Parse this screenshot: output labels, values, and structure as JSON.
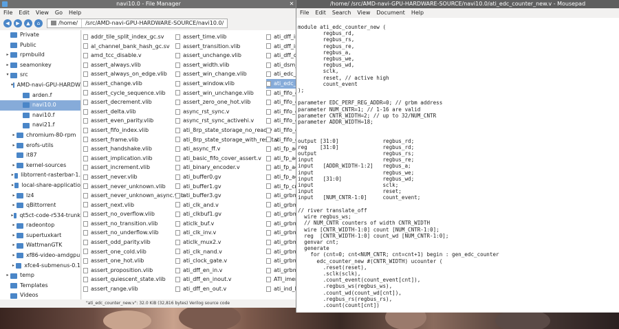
{
  "file_manager": {
    "title": "navi10.0 - File Manager",
    "menu": [
      "File",
      "Edit",
      "View",
      "Go",
      "Help"
    ],
    "path_segments": [
      "/home/",
      "/src/AMD-navi-GPU-HARDWARE-SOURCE/navi10.0/"
    ],
    "sidebar": [
      {
        "label": "Private",
        "indent": 1,
        "arrow": "",
        "color": "#4a86c8"
      },
      {
        "label": "Public",
        "indent": 1,
        "arrow": "",
        "color": "#4a86c8"
      },
      {
        "label": "rpmbuild",
        "indent": 1,
        "arrow": "▸",
        "color": "#4a86c8"
      },
      {
        "label": "seamonkey",
        "indent": 1,
        "arrow": "▸",
        "color": "#4a86c8"
      },
      {
        "label": "src",
        "indent": 1,
        "arrow": "▾",
        "color": "#4a86c8"
      },
      {
        "label": "AMD-navi-GPU-HARDW",
        "indent": 2,
        "arrow": "▾",
        "color": "#4a86c8"
      },
      {
        "label": "arden.f",
        "indent": 3,
        "arrow": "",
        "color": "#4a86c8"
      },
      {
        "label": "navi10.0",
        "indent": 3,
        "arrow": "",
        "color": "#4a86c8",
        "selected": true
      },
      {
        "label": "navi10.f",
        "indent": 3,
        "arrow": "",
        "color": "#4a86c8"
      },
      {
        "label": "navi21.f",
        "indent": 3,
        "arrow": "",
        "color": "#4a86c8"
      },
      {
        "label": "chromium-80-rpm",
        "indent": 2,
        "arrow": "▸",
        "color": "#4a86c8"
      },
      {
        "label": "erofs-utils",
        "indent": 2,
        "arrow": "▸",
        "color": "#4a86c8"
      },
      {
        "label": "it87",
        "indent": 2,
        "arrow": "",
        "color": "#4a86c8"
      },
      {
        "label": "kernel-sources",
        "indent": 2,
        "arrow": "▸",
        "color": "#4a86c8"
      },
      {
        "label": "libtorrent-rasterbar-1.",
        "indent": 2,
        "arrow": "▸",
        "color": "#4a86c8"
      },
      {
        "label": "local-share-applicatio",
        "indent": 2,
        "arrow": "▸",
        "color": "#4a86c8"
      },
      {
        "label": "lz4",
        "indent": 2,
        "arrow": "▸",
        "color": "#4a86c8"
      },
      {
        "label": "qBittorrent",
        "indent": 2,
        "arrow": "▸",
        "color": "#4a86c8"
      },
      {
        "label": "qt5ct-code-r534-trunk",
        "indent": 2,
        "arrow": "▸",
        "color": "#4a86c8"
      },
      {
        "label": "radeontop",
        "indent": 2,
        "arrow": "▸",
        "color": "#4a86c8"
      },
      {
        "label": "supertuxkart",
        "indent": 2,
        "arrow": "▸",
        "color": "#4a86c8"
      },
      {
        "label": "WattmanGTK",
        "indent": 2,
        "arrow": "▸",
        "color": "#4a86c8"
      },
      {
        "label": "xf86-video-amdgpu",
        "indent": 2,
        "arrow": "▸",
        "color": "#4a86c8"
      },
      {
        "label": "xfce4-submenus-0.1",
        "indent": 2,
        "arrow": "▸",
        "color": "#4a86c8"
      },
      {
        "label": "temp",
        "indent": 1,
        "arrow": "▸",
        "color": "#4a86c8"
      },
      {
        "label": "Templates",
        "indent": 1,
        "arrow": "",
        "color": "#4a86c8"
      },
      {
        "label": "Videos",
        "indent": 1,
        "arrow": "",
        "color": "#4a86c8"
      }
    ],
    "columns": [
      [
        "addr_tile_split_index_gc.sv",
        "al_channel_bank_hash_gc.sv",
        "amd_tcc_disable.v",
        "assert_always.vlib",
        "assert_always_on_edge.vlib",
        "assert_change.vlib",
        "assert_cycle_sequence.vlib",
        "assert_decrement.vlib",
        "assert_delta.vlib",
        "assert_even_parity.vlib",
        "assert_fifo_index.vlib",
        "assert_frame.vlib",
        "assert_handshake.vlib",
        "assert_implication.vlib",
        "assert_increment.vlib",
        "assert_never.vlib",
        "assert_never_unknown.vlib",
        "assert_never_unknown_async.vlib",
        "assert_next.vlib",
        "assert_no_overflow.vlib",
        "assert_no_transition.vlib",
        "assert_no_underflow.vlib",
        "assert_odd_parity.vlib",
        "assert_one_cold.vlib",
        "assert_one_hot.vlib",
        "assert_proposition.vlib",
        "assert_quiescent_state.vlib",
        "assert_range.vlib"
      ],
      [
        "assert_time.vlib",
        "assert_transition.vlib",
        "assert_unchange.vlib",
        "assert_width.vlib",
        "assert_win_change.vlib",
        "assert_window.vlib",
        "assert_win_unchange.vlib",
        "assert_zero_one_hot.vlib",
        "async_rst_sync.v",
        "async_rst_sync_activehi.v",
        "ati_8rp_state_storage_no_read.v",
        "ati_8rp_state_storage_with_reset.v",
        "ati_async_ff.v",
        "ati_basic_fifo_cover_assert.v",
        "ati_binary_encoder.v",
        "ati_buffer0.gv",
        "ati_buffer1.gv",
        "ati_buffer3.gv",
        "ati_clk_and.v",
        "ati_clkbuf1.gv",
        "aticlk_buf.v",
        "ati_clk_inv.v",
        "aticlk_mux2.v",
        "ati_clk_nand.v",
        "ati_clock_gate.v",
        "ati_dff_en_in.v",
        "ati_dff_en_inout.v",
        "ati_dff_en_out.v"
      ],
      [
        "ati_dff_in",
        "ati_dff_in",
        "ati_dff_ou",
        "ati_dsm_",
        "ati_edc_c",
        "ati_edc_c",
        "ati_fifo_c",
        "ati_fifo_c",
        "ati_fifo_c",
        "ati_fifo_c",
        "ati_fifo_c",
        "ati_fifo_c",
        "ati_fp_ad",
        "ati_fp_ad",
        "ati_fp_ad",
        "ati_fp_ad",
        "ati_fp_cm",
        "ati_grbm",
        "ati_grbm",
        "ati_grbm",
        "ati_grbm",
        "ati_grbm",
        "ati_grbm",
        "ati_grbm",
        "ati_grbm",
        "ati_grbm",
        "ATI_imem",
        "ati_ind_N"
      ]
    ],
    "selected_file": "ati_edc_c",
    "status": "\"ati_edc_counter_new.v\": 32.0 KiB (32,816 bytes) Verilog source code"
  },
  "mousepad": {
    "title": "/home/        /src/AMD-navi-GPU-HARDWARE-SOURCE/navi10.0/ati_edc_counter_new.v - Mousepad",
    "menu": [
      "File",
      "Edit",
      "Search",
      "View",
      "Document",
      "Help"
    ],
    "code": "module ati_edc_counter_new (\n        regbus_rd,\n        regbus_rs,\n        regbus_re,\n        regbus_a,\n        regbus_we,\n        regbus_wd,\n        sclk,\n        reset, // active high\n        count_event\n);\n\nparameter EDC_PERF_REG_ADDR=0; // grbm address\nparameter NUM_CNTR=1; // 1-16 are valid\nparameter CNTR_WIDTH=2; // up to 32/NUM_CNTR\nparameter ADDR_WIDTH=18;\n\n\noutput [31:0]              regbus_rd;\nreg    [31:0]              regbus_rd;\noutput                     regbus_rs;\ninput                      regbus_re;\ninput   [ADDR_WIDTH-1:2]   regbus_a;\ninput                      regbus_we;\ninput   [31:0]             regbus_wd;\ninput                      sclk;\ninput                      reset;\ninput   [NUM_CNTR-1:0]     count_event;\n\n// river translate_off\n  wire regbus_ws;\n  // NUM_CNTR counters of width CNTR_WIDTH\n  wire [CNTR_WIDTH-1:0] count [NUM_CNTR-1:0];\n  reg  [CNTR_WIDTH-1:0] count_wd [NUM_CNTR-1:0];\n  genvar cnt;\n  generate\n    for (cnt=0; cnt<NUM_CNTR; cnt=cnt+1) begin : gen_edc_counter\n      edc_counter_new #(CNTR_WIDTH) ucounter (\n        .reset(reset),\n        .sclk(sclk),\n        .count_event(count_event[cnt]),\n        .regbus_ws(regbus_ws),\n        .count_wd(count_wd[cnt]),\n        .regbus_rs(regbus_rs),\n        .count(count[cnt])"
  }
}
